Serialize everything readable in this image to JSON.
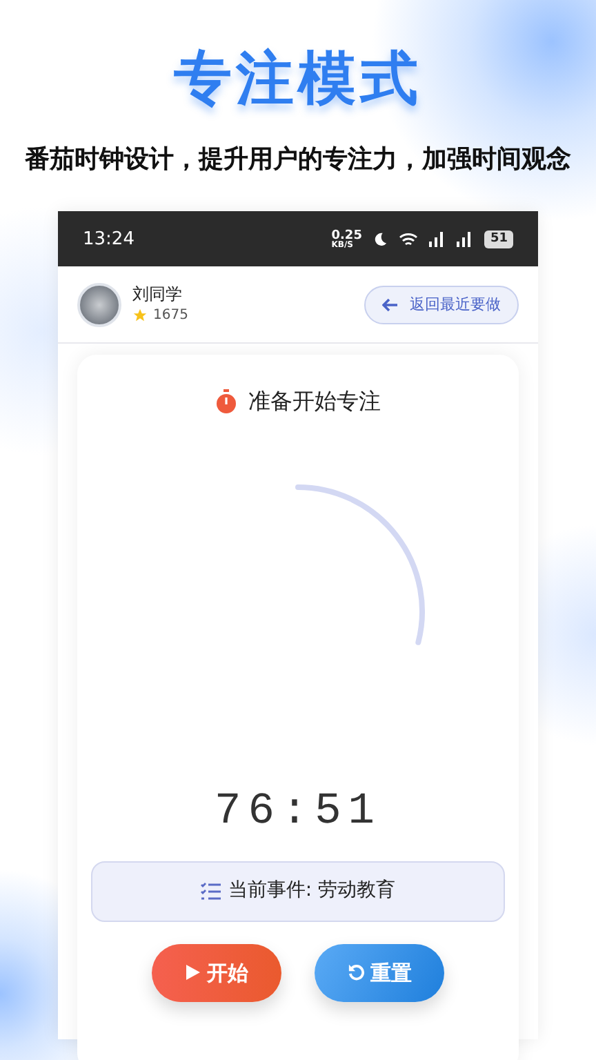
{
  "headline": "专注模式",
  "subtitle": "番茄时钟设计，提升用户的专注力，加强时间观念",
  "status_bar": {
    "time": "13:24",
    "speed_value": "0.25",
    "speed_unit": "KB/S",
    "battery": "51"
  },
  "user": {
    "name": "刘同学",
    "points": "1675"
  },
  "back_button": {
    "label": "返回最近要做"
  },
  "timer": {
    "title": "准备开始专注",
    "reading": "76:51"
  },
  "current_event": {
    "label": "当前事件: 劳动教育"
  },
  "buttons": [
    {
      "kind": "start",
      "label": "开始"
    },
    {
      "kind": "reset",
      "label": "重置"
    }
  ]
}
